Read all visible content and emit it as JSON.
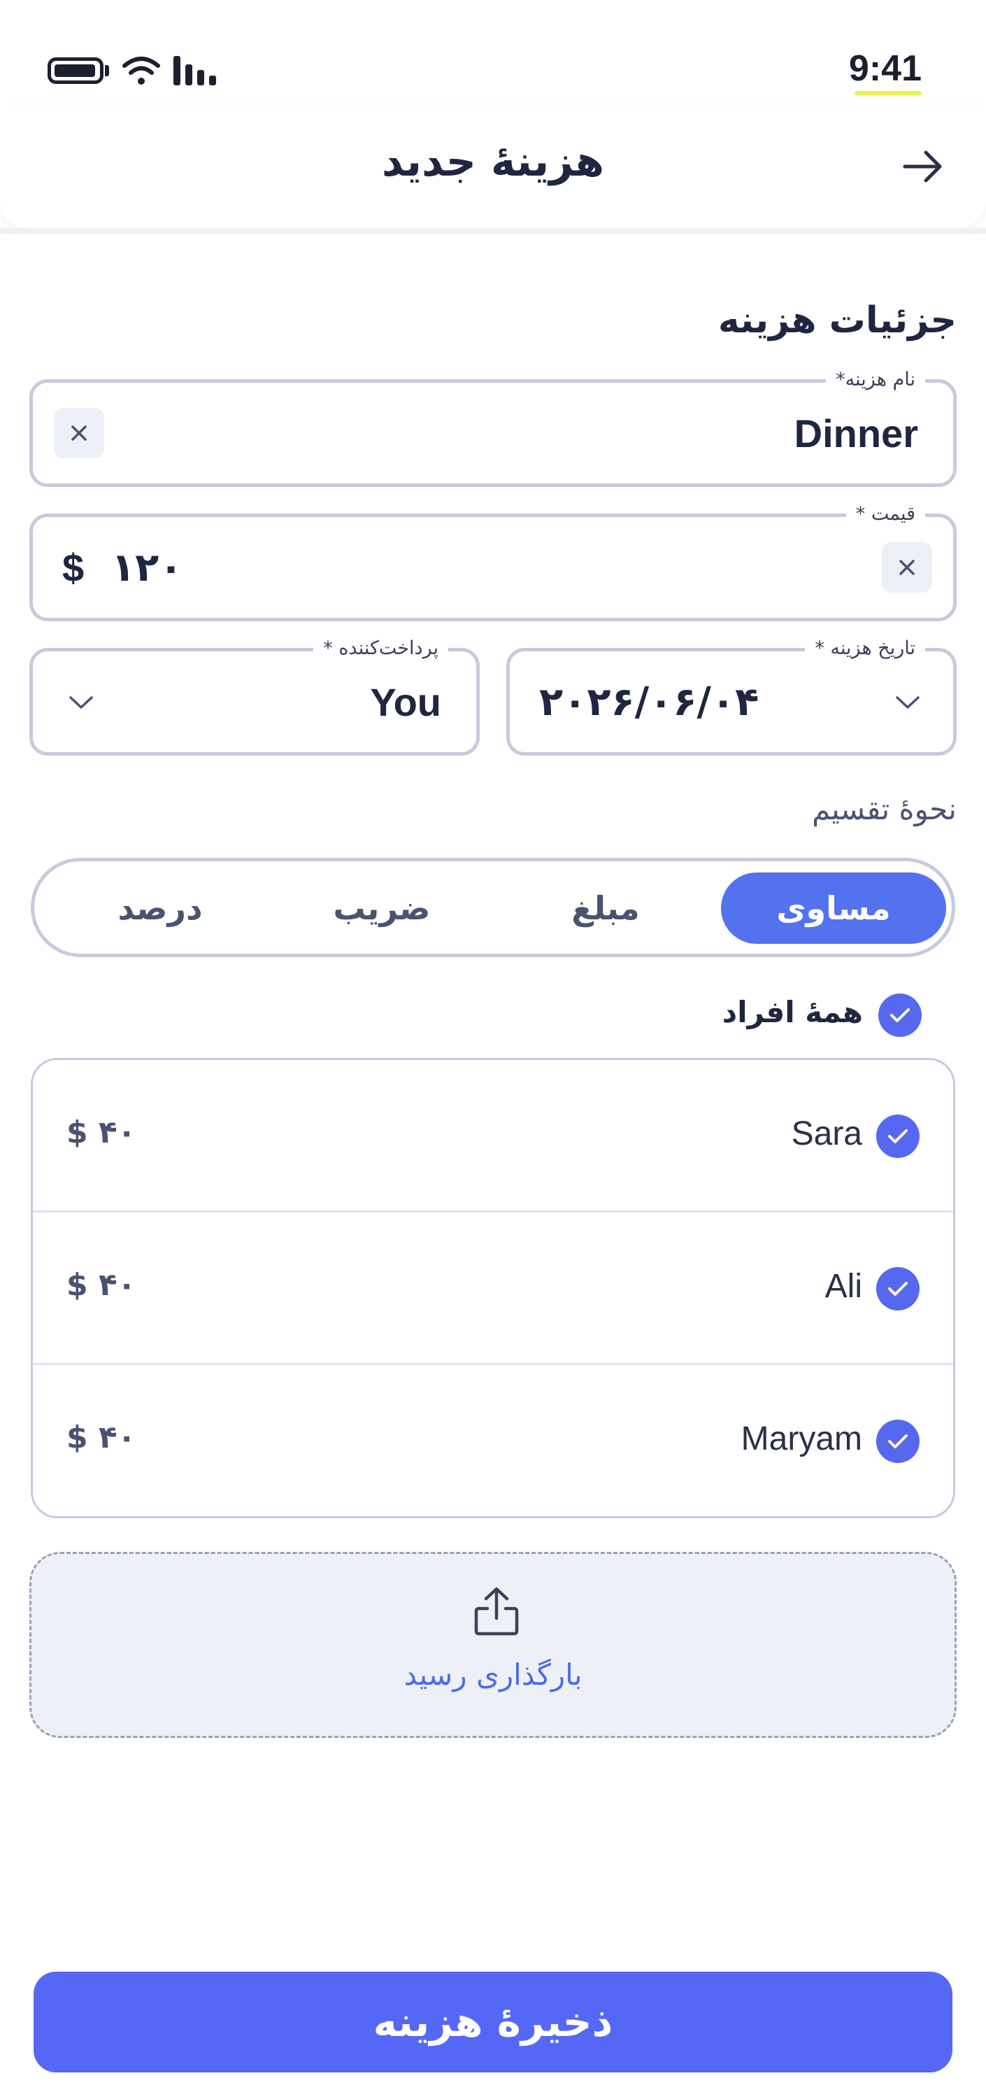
{
  "status_bar": {
    "time": "9:41",
    "icons": [
      "battery-icon",
      "wifi-icon",
      "signal-icon"
    ]
  },
  "header": {
    "title": "هزینهٔ جدید",
    "back_icon": "arrow-right-icon"
  },
  "section_title": "جزئیات هزینه",
  "fields": {
    "name": {
      "label": "نام هزینه*",
      "value": "Dinner",
      "clear_icon": "close-icon"
    },
    "price": {
      "label": "قیمت *",
      "currency": "$",
      "value": "۱۲۰",
      "clear_icon": "close-icon"
    },
    "date": {
      "label": "تاریخ هزینه *",
      "value": "۲۰۲۶/۰۶/۰۴",
      "icon": "chevron-down-icon"
    },
    "payer": {
      "label": "پرداخت‌کننده *",
      "value": "You",
      "icon": "chevron-down-icon"
    }
  },
  "split": {
    "label": "نحوهٔ تقسیم",
    "options": [
      "مساوی",
      "مبلغ",
      "ضریب",
      "درصد"
    ],
    "selected": "مساوی"
  },
  "all_members": {
    "label": "همهٔ افراد",
    "checked": true
  },
  "members": [
    {
      "name": "Sara",
      "amount": "$ ۴۰",
      "checked": true
    },
    {
      "name": "Ali",
      "amount": "$ ۴۰",
      "checked": true
    },
    {
      "name": "Maryam",
      "amount": "$ ۴۰",
      "checked": true
    }
  ],
  "upload": {
    "label": "بارگذاری رسید",
    "icon": "upload-icon"
  },
  "save_button": "ذخیرهٔ هزینه",
  "colors": {
    "accent": "#5568f5",
    "text": "#1f2640",
    "border": "#c6cbdc",
    "upload_bg": "#eef0f8"
  }
}
